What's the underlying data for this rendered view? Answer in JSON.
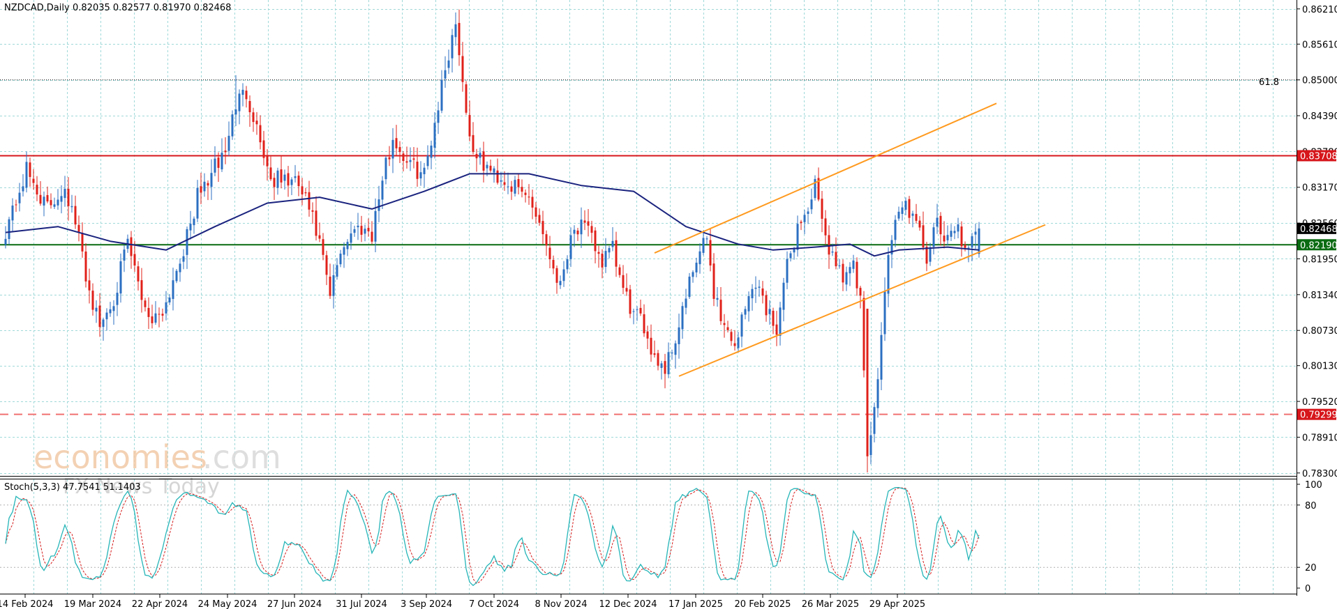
{
  "header": {
    "symbol": "NZDCAD,Daily",
    "ohlc": "0.82035 0.82577 0.81970 0.82468"
  },
  "watermark": {
    "brand_main": "economies",
    "brand_suffix": ".com",
    "tagline": "FX News Today"
  },
  "indicator": {
    "label": "Stoch(5,3,3) 47.7541 51.1403",
    "ticks": [
      "100",
      "80",
      "20",
      "0"
    ]
  },
  "fib_label": "61.8",
  "price_tags": {
    "resistance": "0.83708",
    "current": "0.82468",
    "support": "0.82190",
    "lower": "0.79299"
  },
  "colors": {
    "bull": "#2b6fc2",
    "bear": "#e0201a",
    "ma": "#1a237e",
    "channel": "#ff9a1f",
    "resistance": "#d6161b",
    "support": "#0a6b12",
    "grid": "#9fd8d8",
    "stoch_main": "#26b5b8",
    "stoch_signal": "#d61a1a"
  },
  "chart_data": [
    {
      "type": "candlestick",
      "title": "NZDCAD,Daily",
      "y_ticks": [
        "0.86210",
        "0.85610",
        "0.85000",
        "0.84390",
        "0.83780",
        "0.83170",
        "0.82560",
        "0.81950",
        "0.81340",
        "0.80730",
        "0.80130",
        "0.79520",
        "0.78910",
        "0.78300"
      ],
      "ylim": [
        0.7825,
        0.8635
      ],
      "x_ticks": [
        "14 Feb 2024",
        "19 Mar 2024",
        "22 Apr 2024",
        "24 May 2024",
        "27 Jun 2024",
        "31 Jul 2024",
        "3 Sep 2024",
        "7 Oct 2024",
        "8 Nov 2024",
        "12 Dec 2024",
        "17 Jan 2025",
        "20 Feb 2025",
        "26 Mar 2025",
        "29 Apr 2025"
      ],
      "last": {
        "open": 0.82035,
        "high": 0.82577,
        "low": 0.8197,
        "close": 0.82468
      },
      "close_path": [
        [
          0,
          0.8245
        ],
        [
          6,
          0.8345
        ],
        [
          12,
          0.828
        ],
        [
          17,
          0.832
        ],
        [
          21,
          0.823
        ],
        [
          24,
          0.814
        ],
        [
          27,
          0.808
        ],
        [
          31,
          0.813
        ],
        [
          35,
          0.822
        ],
        [
          39,
          0.813
        ],
        [
          42,
          0.809
        ],
        [
          46,
          0.812
        ],
        [
          49,
          0.818
        ],
        [
          52,
          0.823
        ],
        [
          55,
          0.83
        ],
        [
          59,
          0.834
        ],
        [
          63,
          0.838
        ],
        [
          66,
          0.846
        ],
        [
          69,
          0.848
        ],
        [
          72,
          0.842
        ],
        [
          76,
          0.833
        ],
        [
          80,
          0.833
        ],
        [
          84,
          0.832
        ],
        [
          87,
          0.828
        ],
        [
          90,
          0.822
        ],
        [
          93,
          0.813
        ],
        [
          96,
          0.821
        ],
        [
          99,
          0.824
        ],
        [
          102,
          0.825
        ],
        [
          105,
          0.824
        ],
        [
          108,
          0.833
        ],
        [
          111,
          0.84
        ],
        [
          114,
          0.837
        ],
        [
          117,
          0.835
        ],
        [
          120,
          0.834
        ],
        [
          123,
          0.843
        ],
        [
          126,
          0.852
        ],
        [
          129,
          0.86
        ],
        [
          131,
          0.85
        ],
        [
          133,
          0.84
        ],
        [
          136,
          0.836
        ],
        [
          140,
          0.834
        ],
        [
          143,
          0.833
        ],
        [
          147,
          0.831
        ],
        [
          150,
          0.83
        ],
        [
          153,
          0.826
        ],
        [
          156,
          0.82
        ],
        [
          159,
          0.815
        ],
        [
          162,
          0.824
        ],
        [
          165,
          0.825
        ],
        [
          168,
          0.823
        ],
        [
          171,
          0.819
        ],
        [
          174,
          0.821
        ],
        [
          177,
          0.814
        ],
        [
          180,
          0.81
        ],
        [
          183,
          0.808
        ],
        [
          186,
          0.803
        ],
        [
          189,
          0.801
        ],
        [
          192,
          0.806
        ],
        [
          195,
          0.813
        ],
        [
          198,
          0.819
        ],
        [
          201,
          0.823
        ],
        [
          203,
          0.814
        ],
        [
          206,
          0.808
        ],
        [
          209,
          0.805
        ],
        [
          212,
          0.811
        ],
        [
          215,
          0.816
        ],
        [
          218,
          0.811
        ],
        [
          221,
          0.808
        ],
        [
          224,
          0.818
        ],
        [
          227,
          0.825
        ],
        [
          230,
          0.828
        ],
        [
          232,
          0.832
        ],
        [
          234,
          0.825
        ],
        [
          237,
          0.82
        ],
        [
          240,
          0.817
        ],
        [
          243,
          0.818
        ],
        [
          245,
          0.812
        ],
        [
          247,
          0.786
        ],
        [
          249,
          0.793
        ],
        [
          251,
          0.808
        ],
        [
          253,
          0.82
        ],
        [
          255,
          0.826
        ],
        [
          258,
          0.829
        ],
        [
          261,
          0.825
        ],
        [
          264,
          0.82
        ],
        [
          267,
          0.825
        ],
        [
          270,
          0.822
        ],
        [
          273,
          0.826
        ],
        [
          275,
          0.82
        ],
        [
          277,
          0.822
        ],
        [
          279,
          0.8247
        ]
      ],
      "moving_average": [
        [
          0,
          0.824
        ],
        [
          15,
          0.825
        ],
        [
          30,
          0.8225
        ],
        [
          46,
          0.821
        ],
        [
          60,
          0.825
        ],
        [
          75,
          0.829
        ],
        [
          90,
          0.83
        ],
        [
          105,
          0.828
        ],
        [
          120,
          0.831
        ],
        [
          133,
          0.834
        ],
        [
          150,
          0.834
        ],
        [
          165,
          0.832
        ],
        [
          180,
          0.831
        ],
        [
          195,
          0.825
        ],
        [
          210,
          0.822
        ],
        [
          220,
          0.821
        ],
        [
          232,
          0.8215
        ],
        [
          242,
          0.822
        ],
        [
          249,
          0.82
        ],
        [
          256,
          0.821
        ],
        [
          270,
          0.8215
        ],
        [
          279,
          0.821
        ]
      ],
      "horizontal_levels": {
        "fib_61_8": 0.85,
        "resistance": 0.83708,
        "support": 0.8219,
        "lower_dashed": 0.79299
      },
      "channel": {
        "upper": [
          [
            186,
            0.8205
          ],
          [
            284,
            0.846
          ]
        ],
        "lower": [
          [
            193,
            0.7995
          ],
          [
            298,
            0.8253
          ]
        ]
      }
    },
    {
      "type": "line",
      "title": "Stoch(5,3,3) 47.7541 51.1403",
      "ylim": [
        0,
        100
      ],
      "y_ticks": [
        "100",
        "80",
        "20",
        "0"
      ],
      "levels": [
        80,
        20
      ],
      "series": [
        {
          "name": "main",
          "last": 47.7541
        },
        {
          "name": "signal",
          "last": 51.1403
        }
      ]
    }
  ]
}
